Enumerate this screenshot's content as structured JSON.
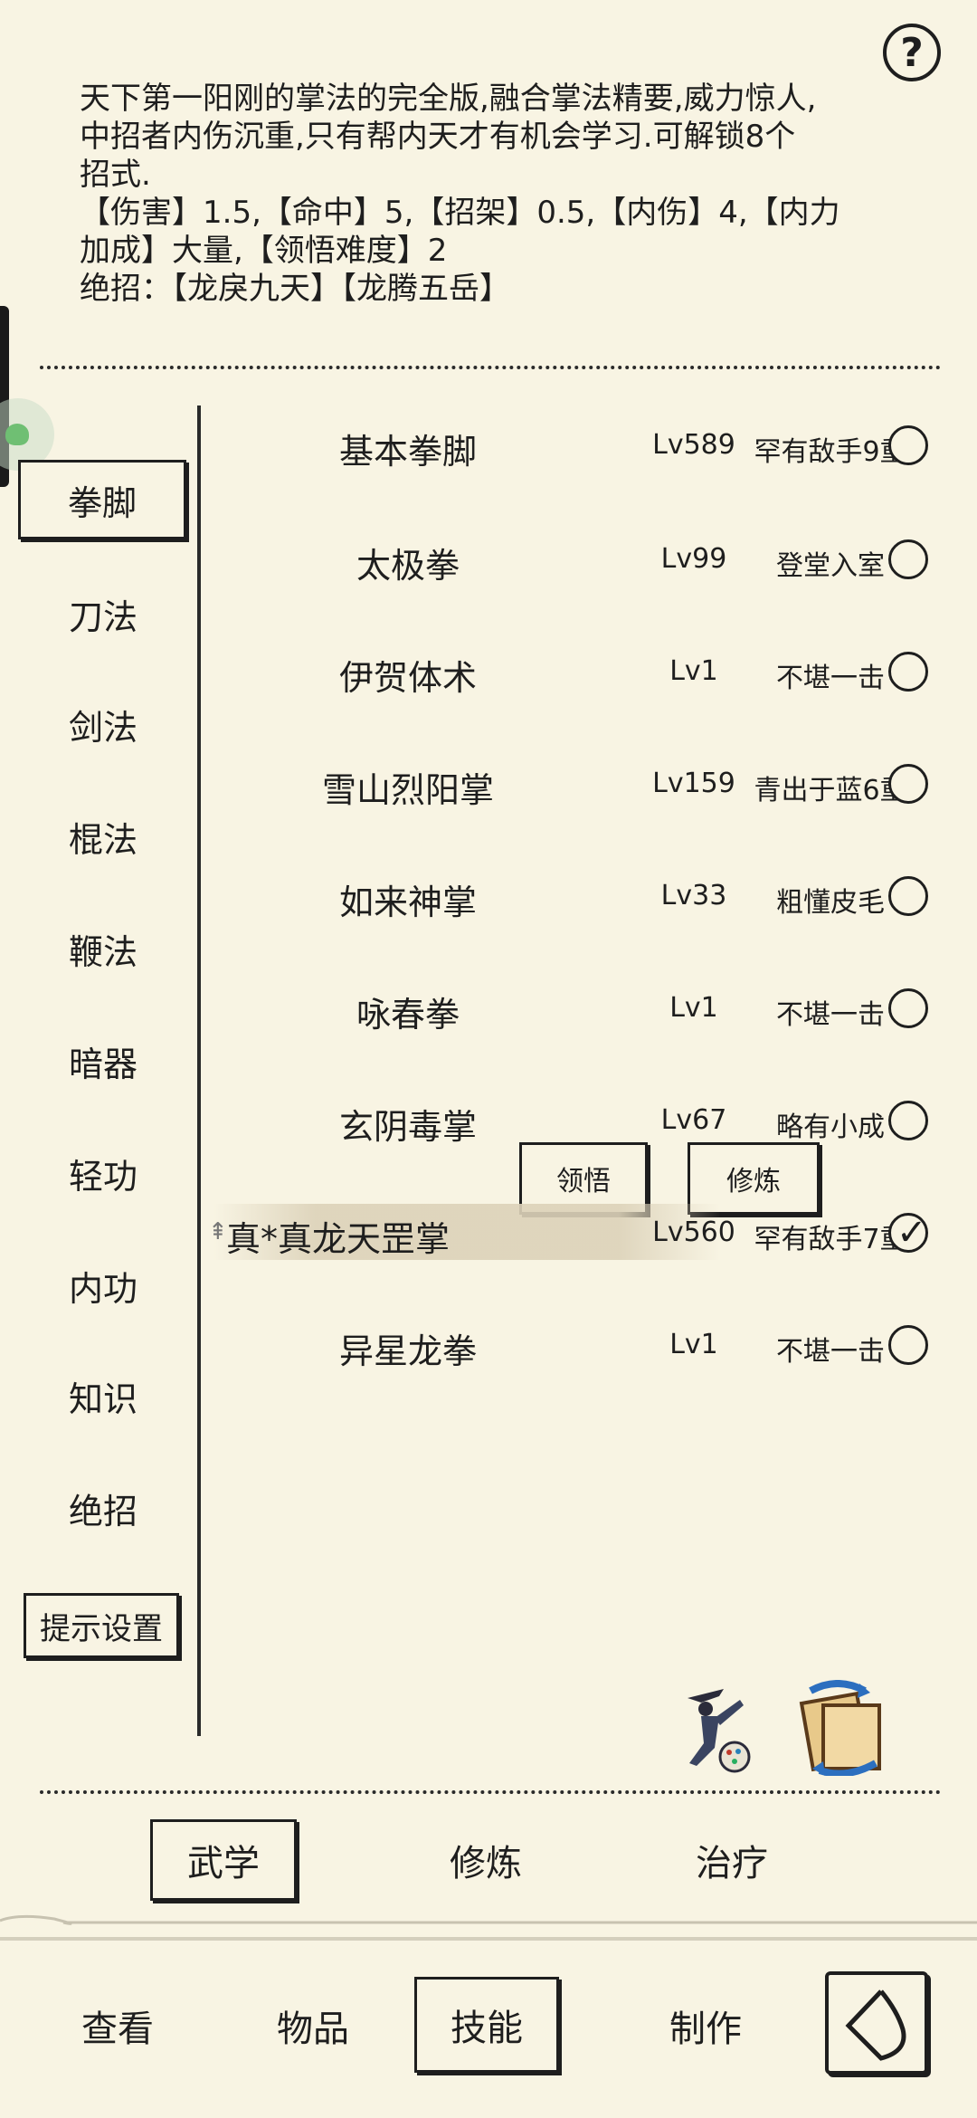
{
  "help": {
    "label": "?"
  },
  "description": {
    "lines": [
      "天下第一阳刚的掌法的完全版,融合掌法精要,威力惊人,",
      "中招者内伤沉重,只有帮内天才有机会学习.可解锁8个",
      "招式.",
      "【伤害】1.5,【命中】5,【招架】0.5,【内伤】4,【内力",
      "加成】大量,【领悟难度】2",
      "绝招：【龙戾九天】【龙腾五岳】"
    ]
  },
  "categories": [
    "拳脚",
    "刀法",
    "剑法",
    "棍法",
    "鞭法",
    "暗器",
    "轻功",
    "内功",
    "知识",
    "绝招"
  ],
  "hint_settings": "提示设置",
  "skills": [
    {
      "name": "基本拳脚",
      "level": "Lv589",
      "rank": "罕有敌手9重",
      "checked": false
    },
    {
      "name": "太极拳",
      "level": "Lv99",
      "rank": "登堂入室",
      "checked": false
    },
    {
      "name": "伊贺体术",
      "level": "Lv1",
      "rank": "不堪一击",
      "checked": false
    },
    {
      "name": "雪山烈阳掌",
      "level": "Lv159",
      "rank": "青出于蓝6重",
      "checked": false
    },
    {
      "name": "如来神掌",
      "level": "Lv33",
      "rank": "粗懂皮毛",
      "checked": false
    },
    {
      "name": "咏春拳",
      "level": "Lv1",
      "rank": "不堪一击",
      "checked": false
    },
    {
      "name": "玄阴毒掌",
      "level": "Lv67",
      "rank": "略有小成",
      "checked": false
    },
    {
      "name": "真*真龙天罡掌",
      "level": "Lv560",
      "rank": "罕有敌手7重",
      "checked": true
    },
    {
      "name": "异星龙拳",
      "level": "Lv1",
      "rank": "不堪一击",
      "checked": false
    }
  ],
  "actions": {
    "comprehend": "领悟",
    "train": "修炼"
  },
  "subtabs": [
    "武学",
    "修炼",
    "治疗"
  ],
  "bottom_nav": [
    "查看",
    "物品",
    "技能",
    "制作"
  ]
}
